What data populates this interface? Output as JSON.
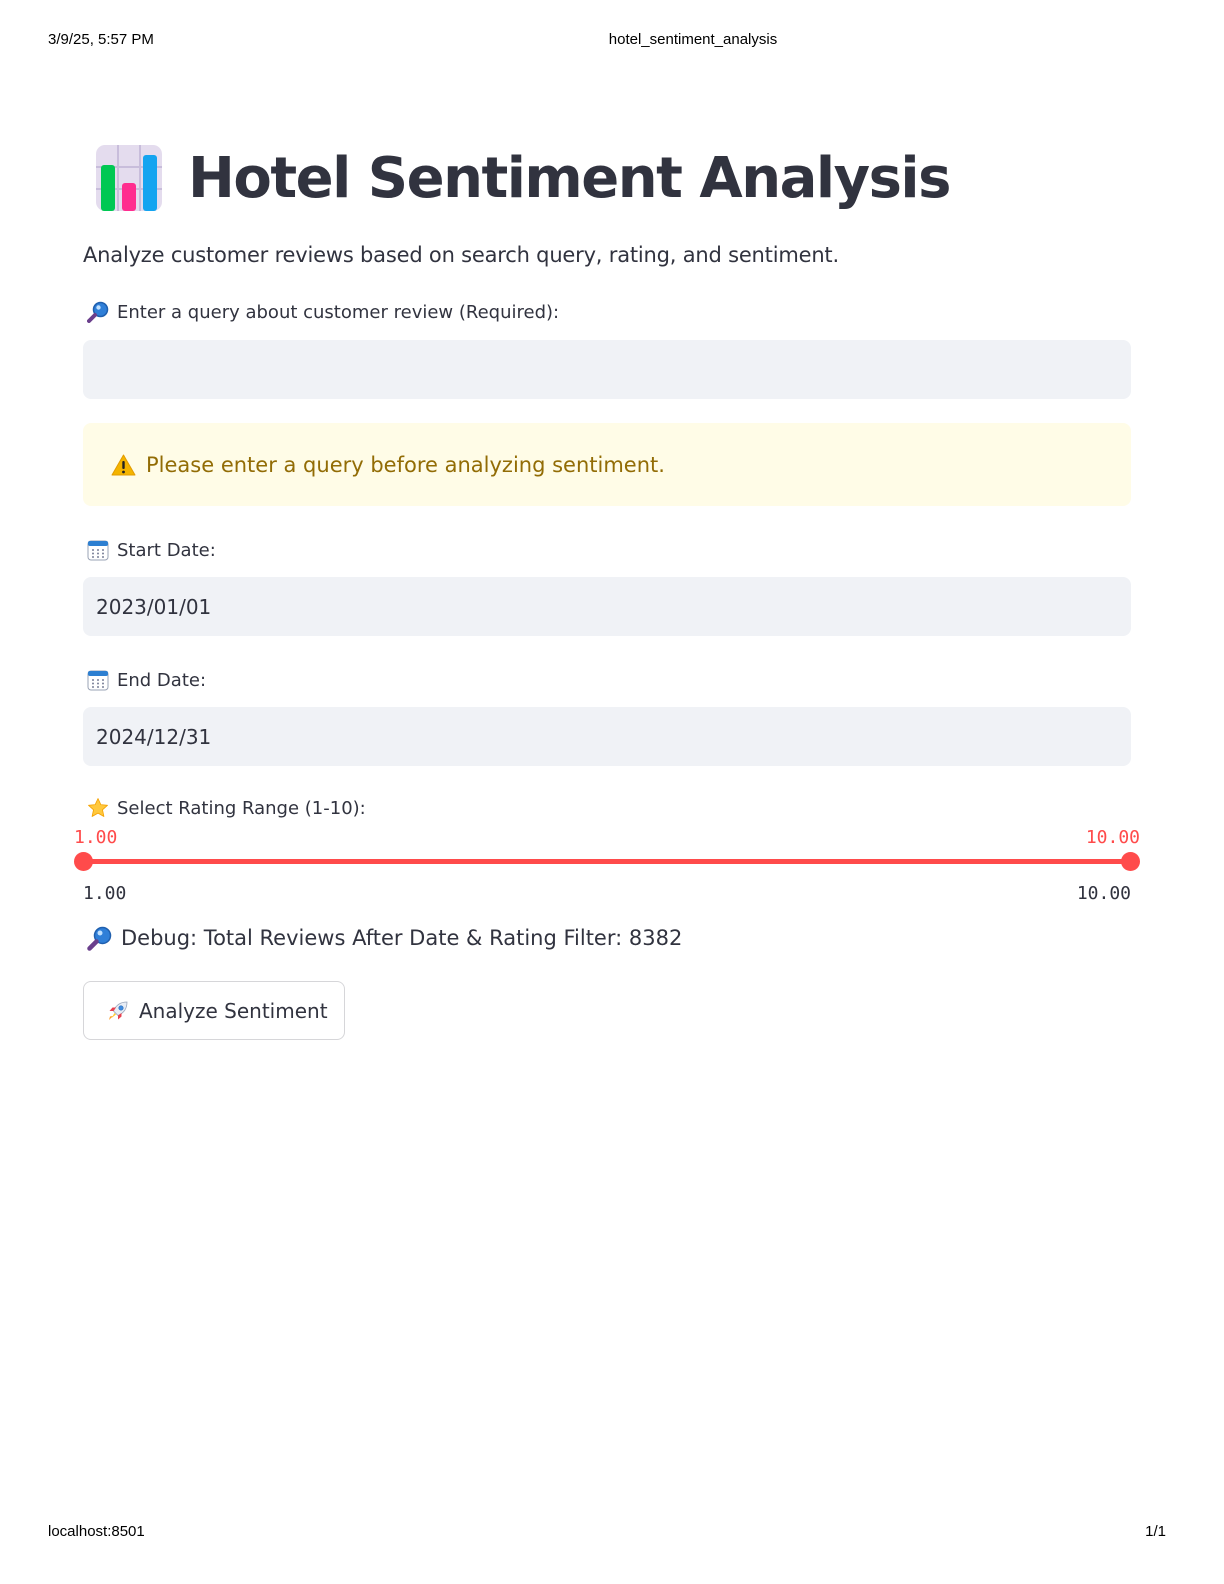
{
  "print": {
    "datetime": "3/9/25, 5:57 PM",
    "document_title": "hotel_sentiment_analysis",
    "url": "localhost:8501",
    "page_number": "1/1"
  },
  "header": {
    "icon": "bar-chart-icon",
    "title": "Hotel Sentiment Analysis",
    "subtitle": "Analyze customer reviews based on search query, rating, and sentiment."
  },
  "query": {
    "icon": "magnifying-glass-icon",
    "label": "Enter a query about customer review (Required):",
    "value": "",
    "placeholder": ""
  },
  "warning": {
    "icon": "warning-icon",
    "text": "Please enter a query before analyzing sentiment.",
    "background": "#fffce7",
    "text_color": "#926c05"
  },
  "start_date": {
    "icon": "calendar-icon",
    "label": "Start Date:",
    "value": "2023/01/01"
  },
  "end_date": {
    "icon": "calendar-icon",
    "label": "End Date:",
    "value": "2024/12/31"
  },
  "rating": {
    "icon": "star-icon",
    "label": "Select Rating Range (1-10):",
    "selected_min": "1.00",
    "selected_max": "10.00",
    "range_min": "1.00",
    "range_max": "10.00",
    "accent_color": "#ff4b4b"
  },
  "debug": {
    "icon": "magnifying-glass-icon",
    "text": "Debug: Total Reviews After Date & Rating Filter: 8382"
  },
  "analyze_button": {
    "icon": "rocket-icon",
    "label": "Analyze Sentiment"
  }
}
